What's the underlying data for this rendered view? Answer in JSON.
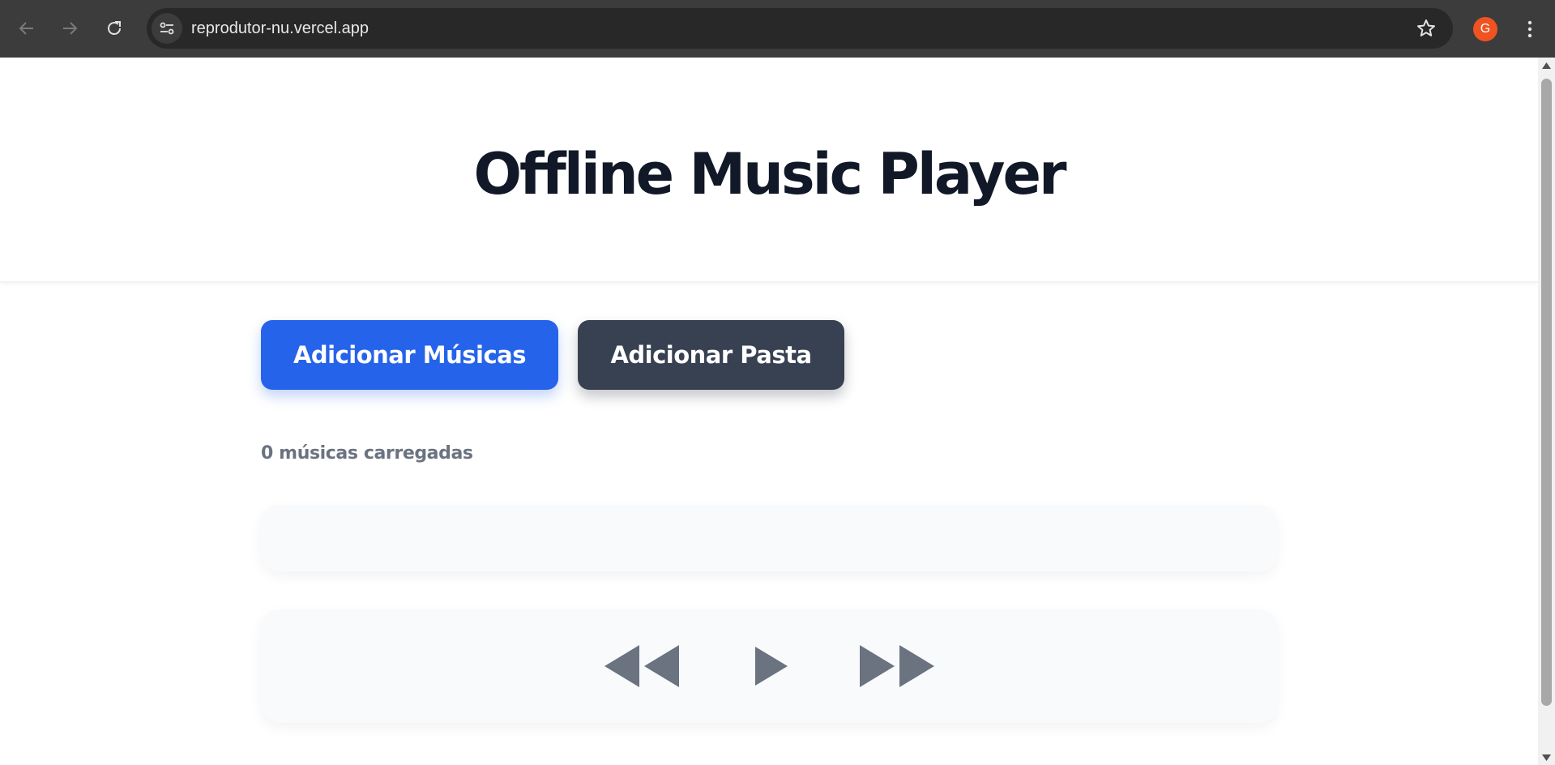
{
  "browser": {
    "url": "reprodutor-nu.vercel.app",
    "profile_initial": "G",
    "colors": {
      "toolbar": "#3c3c3c",
      "omnibox": "#282828",
      "avatar": "#f05222"
    },
    "icons": [
      "back-arrow-icon",
      "forward-arrow-icon",
      "reload-icon",
      "site-info-icon",
      "bookmark-star-icon",
      "kebab-menu-icon"
    ]
  },
  "page": {
    "title": "Offline Music Player",
    "buttons": {
      "add_music": "Adicionar Músicas",
      "add_folder": "Adicionar Pasta"
    },
    "songs_loaded": "0 músicas carregadas",
    "controls": [
      "previous-icon",
      "play-icon",
      "next-icon"
    ],
    "colors": {
      "primary": "#2563eb",
      "secondary": "#374151",
      "title": "#111827",
      "muted": "#6b7280",
      "panel": "#f9fafb"
    }
  }
}
